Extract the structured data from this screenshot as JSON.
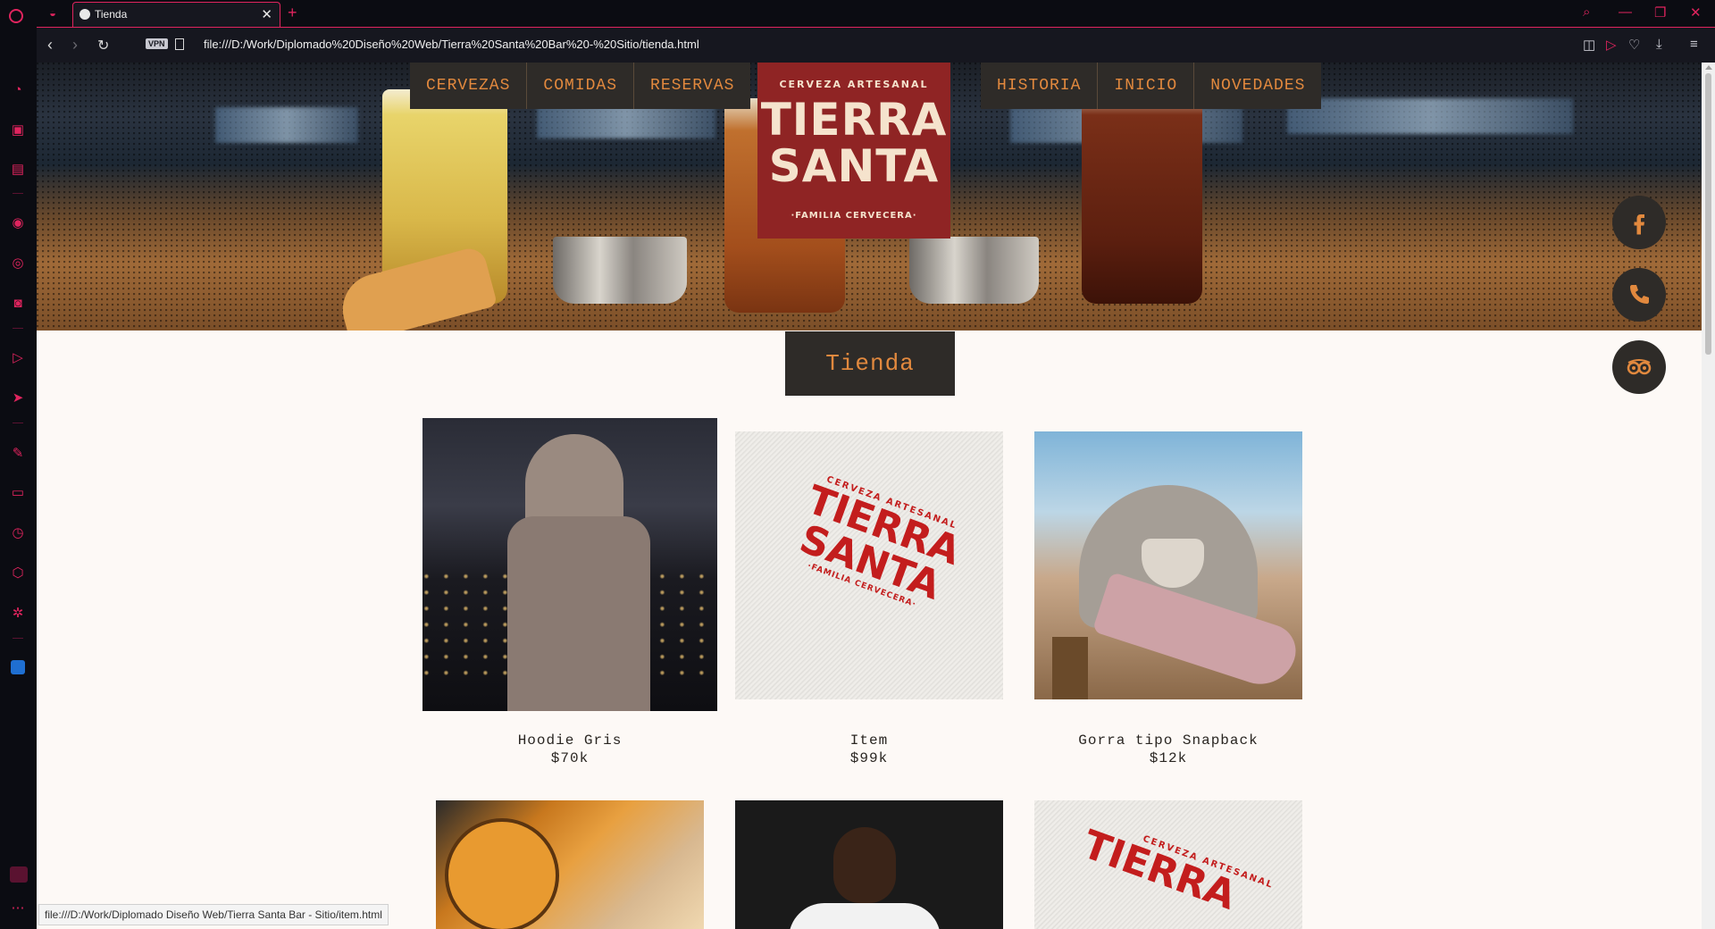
{
  "browser": {
    "tab_title": "Tienda",
    "url": "file:///D:/Work/Diplomado%20Diseño%20Web/Tierra%20Santa%20Bar%20-%20Sitio/tienda.html",
    "vpn_label": "VPN",
    "status_url": "file:///D:/Work/Diplomado Diseño Web/Tierra Santa Bar - Sitio/item.html",
    "accent_color": "#e0245e"
  },
  "nav": {
    "left": [
      "CERVEZAS",
      "COMIDAS",
      "RESERVAS"
    ],
    "right": [
      "HISTORIA",
      "INICIO",
      "NOVEDADES"
    ]
  },
  "logo": {
    "top": "CERVEZA ARTESANAL",
    "line1": "TIERRA",
    "line2": "SANTA",
    "bottom": "·FAMILIA CERVECERA·"
  },
  "social": [
    "facebook-icon",
    "phone-icon",
    "tripadvisor-icon"
  ],
  "page_title": "Tienda",
  "products": [
    {
      "name": "Hoodie Gris",
      "price": "$70k"
    },
    {
      "name": "Item",
      "price": "$99k"
    },
    {
      "name": "Gorra tipo Snapback",
      "price": "$12k"
    }
  ],
  "mock_label": {
    "top": "CERVEZA ARTESANAL",
    "line1": "TIERRA",
    "line2": "SANTA",
    "bottom": "·FAMILIA CERVECERA·"
  },
  "colors": {
    "nav_bg": "#2e2b28",
    "nav_text": "#e2893e",
    "logo_bg": "#8f2424",
    "page_bg": "#fdf9f6"
  }
}
